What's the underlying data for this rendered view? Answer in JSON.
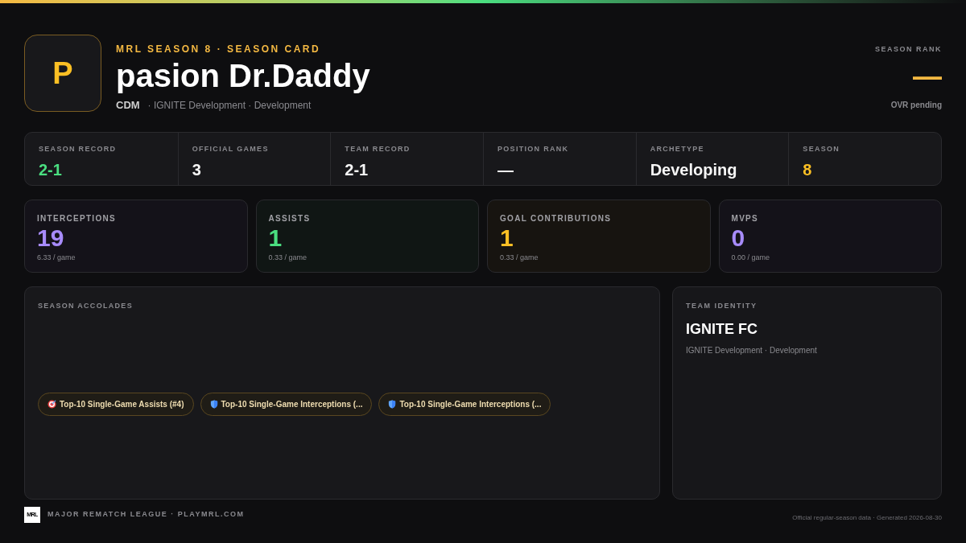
{
  "header": {
    "avatar_letter": "P",
    "eyebrow": "MRL SEASON 8 · SEASON CARD",
    "player_name": "pasion Dr.Daddy",
    "position": "CDM",
    "team_line": "· IGNITE Development · Development"
  },
  "season_rank": {
    "label": "SEASON RANK",
    "value": "—",
    "note": "OVR pending"
  },
  "summary": [
    {
      "label": "SEASON RECORD",
      "value": "2-1",
      "color": "#4ade80"
    },
    {
      "label": "OFFICIAL GAMES",
      "value": "3",
      "color": "#f5f5f5"
    },
    {
      "label": "TEAM RECORD",
      "value": "2-1",
      "color": "#f5f5f5"
    },
    {
      "label": "POSITION RANK",
      "value": "—",
      "color": "#f5f5f5"
    },
    {
      "label": "ARCHETYPE",
      "value": "Developing",
      "color": "#f5f5f5"
    },
    {
      "label": "SEASON",
      "value": "8",
      "color": "#fbbf24"
    }
  ],
  "stats": [
    {
      "label": "INTERCEPTIONS",
      "value": "19",
      "per_game": "6.33 / game",
      "color": "#a78bfa"
    },
    {
      "label": "ASSISTS",
      "value": "1",
      "per_game": "0.33 / game",
      "color": "#4ade80"
    },
    {
      "label": "GOAL CONTRIBUTIONS",
      "value": "1",
      "per_game": "0.33 / game",
      "color": "#fbbf24"
    },
    {
      "label": "MVPS",
      "value": "0",
      "per_game": "0.00 / game",
      "color": "#a78bfa"
    }
  ],
  "accolades": {
    "title": "SEASON ACCOLADES",
    "items": [
      {
        "kind": "target",
        "label": "Top-10 Single-Game Assists (#4)"
      },
      {
        "kind": "shield",
        "label": "Top-10 Single-Game Interceptions (..."
      },
      {
        "kind": "shield",
        "label": "Top-10 Single-Game Interceptions (..."
      }
    ]
  },
  "team_identity": {
    "title": "TEAM IDENTITY",
    "team_name": "IGNITE FC",
    "subtitle": "IGNITE Development · Development"
  },
  "footer": {
    "logo_text": "MRL",
    "league": "MAJOR REMATCH LEAGUE · PLAYMRL.COM",
    "note": "Official regular-season data · Generated 2026-08-30"
  }
}
